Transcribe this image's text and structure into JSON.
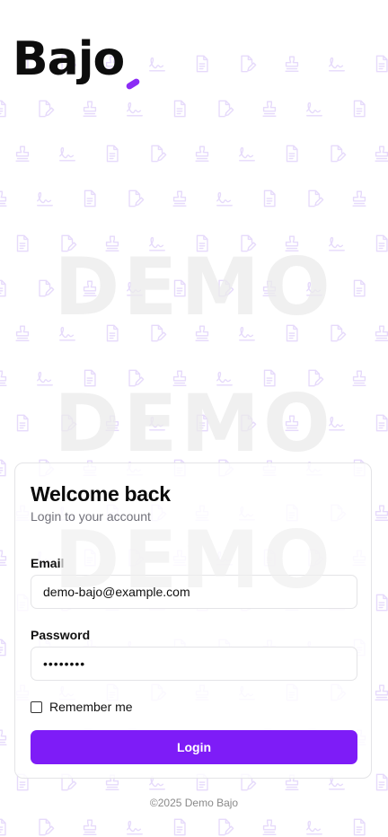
{
  "brand": {
    "logo_text": "Bajo",
    "accent_color": "#7e1cf7",
    "logo_stroke_color": "#8b2cf5"
  },
  "background": {
    "watermark_text": "DEMO",
    "pattern_icons": [
      "document-icon",
      "edit-document-icon",
      "stamp-icon",
      "signature-icon"
    ],
    "pattern_color": "#ede4ff"
  },
  "login_card": {
    "title": "Welcome back",
    "subtitle": "Login to your account",
    "email_label": "Email",
    "email_value": "demo-bajo@example.com",
    "password_label": "Password",
    "password_value": "••••••••",
    "remember_label": "Remember me",
    "remember_checked": false,
    "login_button": "Login"
  },
  "footer": {
    "copyright": "©2025 Demo Bajo"
  }
}
